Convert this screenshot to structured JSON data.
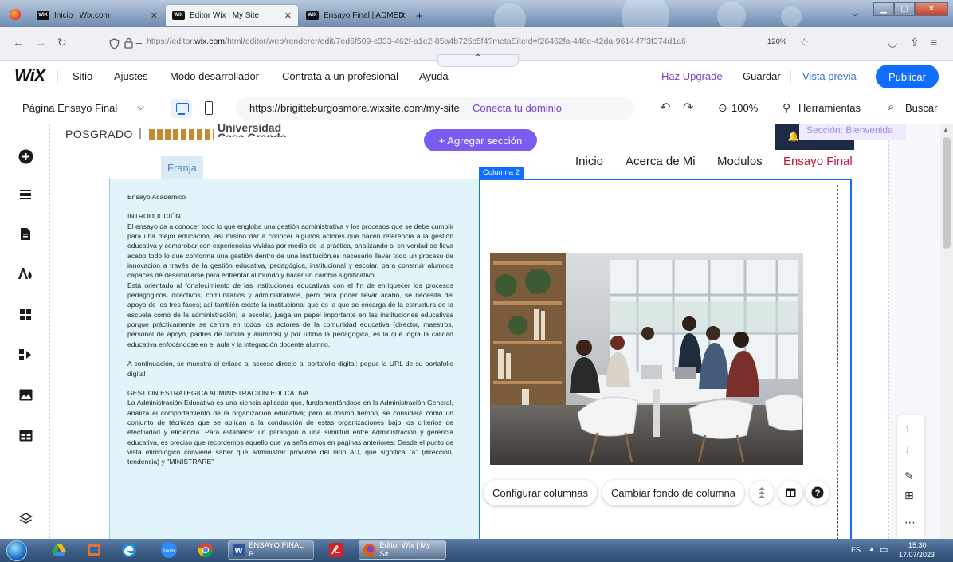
{
  "browser": {
    "tabs": [
      {
        "label": "Inicio | Wix.com",
        "active": false
      },
      {
        "label": "Editor Wix | My Site",
        "active": true
      },
      {
        "label": "Ensayo Final | ADMEDUCDZM",
        "active": false
      }
    ],
    "url_prefix": "https://editor.",
    "url_domain": "wix.com",
    "url_rest": "/html/editor/web/renderer/edit/7ed6f509-c333-462f-a1e2-85a4b725c5f4?metaSiteId=f26462fa-446e-42da-9614-f7f3f374d1a6",
    "zoom": "120%"
  },
  "wix_menu": {
    "logo": "WiX",
    "items": [
      "Sitio",
      "Ajustes",
      "Modo desarrollador",
      "Contrata a un profesional",
      "Ayuda"
    ],
    "upgrade": "Haz Upgrade",
    "save": "Guardar",
    "preview": "Vista previa",
    "publish": "Publicar"
  },
  "toolbar2": {
    "page": "Página Ensayo Final",
    "site_url": "https://brigitteburgosmore.wixsite.com/my-site",
    "connect": "Conecta tu dominio",
    "zoom": "100%",
    "tools": "Herramientas",
    "search": "Buscar"
  },
  "canvas": {
    "posgrado": "POSGRADO",
    "university": "Universidad Casa Grande",
    "add_section": "+ Agregar sección",
    "section_label": "Sección: Bienvenida",
    "franja": "Franja",
    "nav": [
      "Inicio",
      "Acerca de Mi",
      "Modulos",
      "Ensayo Final"
    ],
    "column2_label": "Columna 2",
    "configure_columns": "Configurar columnas",
    "change_bg": "Cambiar fondo de columna"
  },
  "essay": {
    "title": "Ensayo Académico",
    "intro_heading": "INTRODUCCIÓN",
    "intro_p1": "El ensayo da a conocer todo lo que engloba una gestión administrativa y los procesos que se debe cumplir para una mejor educación, así mismo dar a conocer algunos actores que hacen referencia a la gestión educativa y comprobar con experiencias vividas por medio de la práctica, analizando si en verdad se lleva acabo todo lo que conforma una gestión dentro de una institución.es necesario llevar todo un proceso de innovación a través de la gestión educativa, pedagógica, institucional y escolar, para construir alumnos capaces de desarrollarse para enfrentar al mundo y hacer un cambio significativo.",
    "intro_p2": "Está orientado al fortalecimiento de las instituciones educativas con el fin de enriquecer los procesos pedagógicos, directivos, comunitarios y administrativos, pero para poder llevar acabo, se necesita del apoyo de los tres fases; así también existe la institucional que es la que se encarga de la estructura de la escuela como de la administración; la escolar, juega un papel importante en las instituciones educativas porque prácticamente se centra en todos los actores de la comunidad educativa (director, maestros, personal de apoyo, padres de familia y alumnos) y por último la pedagógica, es la que logra la calidad educativa enfocándose en el aula y la integración docente alumno.",
    "portfolio_p": "A continuación, se muestra el enlace al acceso directo al portafolio digital: pegue la URL de su portafolio digital",
    "gestion_heading": "GESTION ESTRATEGICA ADMINISTRACION EDUCATIVA",
    "gestion_p": "La Administración Educativa es una ciencia aplicada que, fundamentándose en la Administración General, analiza el comportamiento de la organización educativa; pero al mismo tiempo, se considera como un conjunto de técnicas que se aplican a la conducción de estas organizaciones bajo los criterios de efectividad y eficiencia. Para establecer un parangón o una similitud entre Administración y gerencia educativa, es preciso que recordemos aquello que ya señalamos en páginas anteriores: Desde el punto de vista etimológico conviene saber que administrar proviene del latín AD, que significa \"a\" (dirección, tendencia) y \"MINISTRARE\""
  },
  "taskbar": {
    "zoom_app": "zoom",
    "word_task": "ENSAYO FINAL B...",
    "firefox_task": "Editor Wix | My Sit...",
    "lang": "ES",
    "time": "15:30",
    "date": "17/07/2023"
  }
}
